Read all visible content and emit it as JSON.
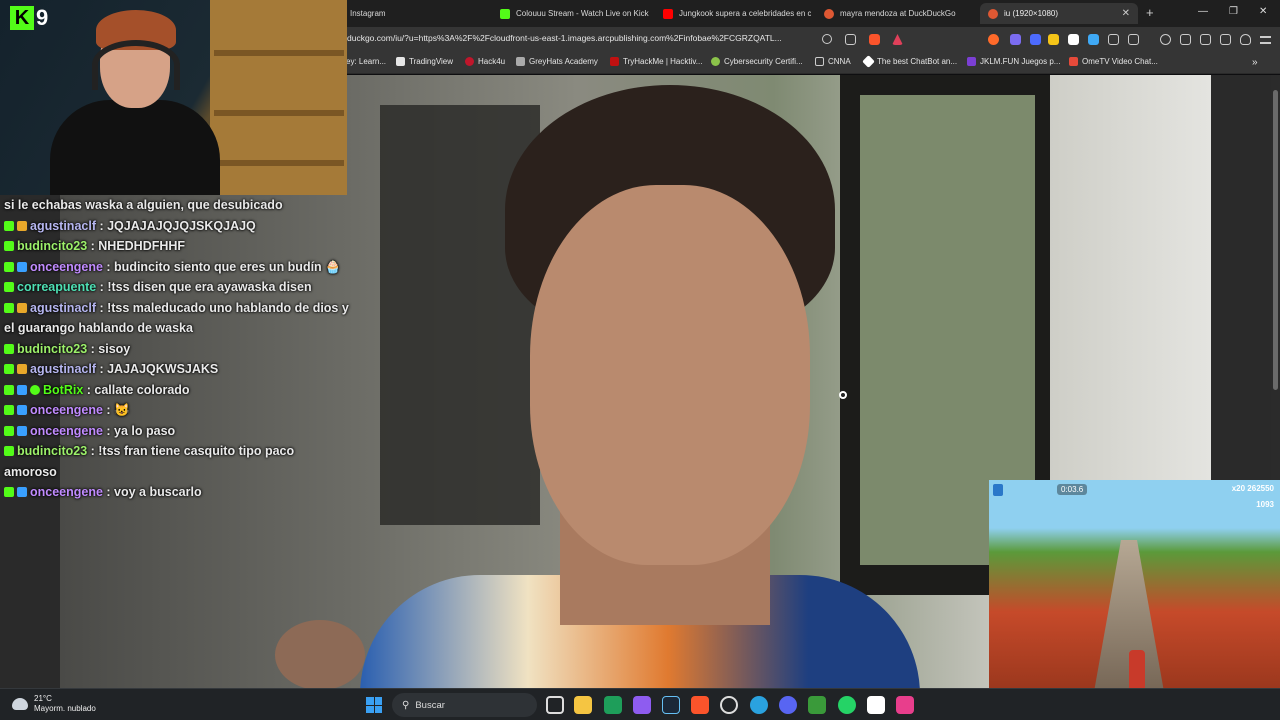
{
  "tabs": [
    {
      "title": "Instagram",
      "color": "#d83a7a",
      "active": false
    },
    {
      "title": "Colouuu Stream - Watch Live on Kick",
      "color": "#53fc18",
      "active": false
    },
    {
      "title": "Jungkook supera a celebridades en c",
      "color": "#ff0000",
      "active": false
    },
    {
      "title": "mayra mendoza at DuckDuckGo",
      "color": "#de5833",
      "active": false
    },
    {
      "title": "iu (1920×1080)",
      "color": "#de5833",
      "active": true
    }
  ],
  "address_bar": {
    "url": "duckgo.com/iu/?u=https%3A%2F%2Fcloudfront-us-east-1.images.arcpublishing.com%2Finfobae%2FCGRZQATL..."
  },
  "bookmarks": [
    {
      "label": "ey: Learn...",
      "color": "#888888"
    },
    {
      "label": "TradingView",
      "color": "#e6e6e6"
    },
    {
      "label": "Hack4u",
      "color": "#c0162b"
    },
    {
      "label": "GreyHats Academy",
      "color": "#aaaaaa"
    },
    {
      "label": "TryHackMe | Hacktiv...",
      "color": "#c11111"
    },
    {
      "label": "Cybersecurity Certifi...",
      "color": "#8bc34a"
    },
    {
      "label": "CNNA",
      "color": "#cccccc"
    },
    {
      "label": "The best ChatBot an...",
      "color": "#ffffff"
    },
    {
      "label": "JKLM.FUN Juegos p...",
      "color": "#7b3fd4"
    },
    {
      "label": "OmeTV Video Chat...",
      "color": "#e64a3a"
    }
  ],
  "stream": {
    "channel_badge_number": "9",
    "chat": [
      {
        "user": "",
        "user_color": "#eaeaea",
        "badges": [],
        "text": "si le echabas waska a alguien, que desubicado"
      },
      {
        "user": "agustinaclf",
        "user_color": "#b6b6f0",
        "badges": [
          "k",
          "og"
        ],
        "text": "JQJAJAJQJQJSKQJAJQ"
      },
      {
        "user": "budincito23",
        "user_color": "#9cf06a",
        "badges": [
          "k"
        ],
        "text": "NHEDHDFHHF"
      },
      {
        "user": "onceengene",
        "user_color": "#c18bff",
        "badges": [
          "k",
          "vip"
        ],
        "text": "budincito siento que eres un budín 🧁"
      },
      {
        "user": "correapuente",
        "user_color": "#4ee0b4",
        "badges": [
          "k"
        ],
        "text": "!tss disen que era ayawaska disen"
      },
      {
        "user": "agustinaclf",
        "user_color": "#b6b6f0",
        "badges": [
          "k",
          "og"
        ],
        "text": "!tss maleducado uno hablando de dios y el guarango hablando de waska"
      },
      {
        "user": "budincito23",
        "user_color": "#9cf06a",
        "badges": [
          "k"
        ],
        "text": "sisoy"
      },
      {
        "user": "agustinaclf",
        "user_color": "#b6b6f0",
        "badges": [
          "k",
          "og"
        ],
        "text": "JAJAJQKWSJAKS"
      },
      {
        "user": "BotRix",
        "user_color": "#53fc18",
        "badges": [
          "k",
          "vip",
          "bot"
        ],
        "text": "callate colorado"
      },
      {
        "user": "onceengene",
        "user_color": "#c18bff",
        "badges": [
          "k",
          "vip"
        ],
        "text": "😺"
      },
      {
        "user": "onceengene",
        "user_color": "#c18bff",
        "badges": [
          "k",
          "vip"
        ],
        "text": "ya lo paso"
      },
      {
        "user": "budincito23",
        "user_color": "#9cf06a",
        "badges": [
          "k"
        ],
        "text": "!tss fran tiene casquito tipo paco amoroso"
      },
      {
        "user": "onceengene",
        "user_color": "#c18bff",
        "badges": [
          "k",
          "vip"
        ],
        "text": "voy a buscarlo"
      }
    ]
  },
  "pip_game": {
    "time": "0:03.6",
    "multiplier": "x20",
    "score": "262550",
    "coins": "1093"
  },
  "taskbar": {
    "temperature": "21°C",
    "weather": "Mayorm. nublado",
    "search_placeholder": "Buscar"
  }
}
